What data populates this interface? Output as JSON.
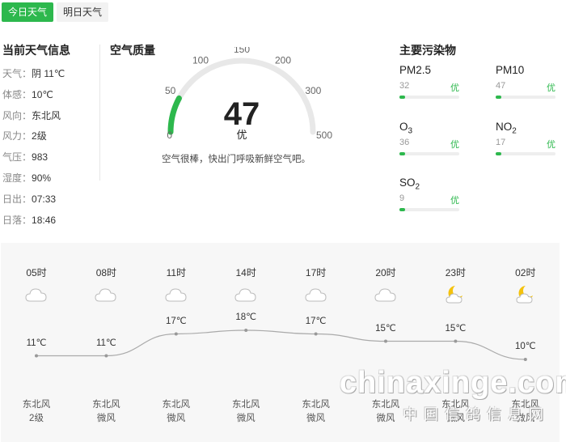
{
  "tabs": [
    {
      "label": "今日天气",
      "active": true
    },
    {
      "label": "明日天气",
      "active": false
    }
  ],
  "current": {
    "title": "当前天气信息",
    "items": [
      {
        "label": "天气：",
        "value": "阴 11℃"
      },
      {
        "label": "体感：",
        "value": "10℃"
      },
      {
        "label": "风向：",
        "value": "东北风"
      },
      {
        "label": "风力：",
        "value": "2级"
      },
      {
        "label": "气压：",
        "value": "983"
      },
      {
        "label": "湿度：",
        "value": "90%"
      },
      {
        "label": "日出：",
        "value": "07:33"
      },
      {
        "label": "日落：",
        "value": "18:46"
      }
    ]
  },
  "air_quality": {
    "title": "空气质量",
    "aqi": "47",
    "aqi_value": 47,
    "aqi_max": 500,
    "level": "优",
    "description": "空气很棒，快出门呼吸新鲜空气吧。",
    "scale_labels": [
      "0",
      "50",
      "100",
      "150",
      "200",
      "300",
      "500"
    ],
    "accent_color": "#2db84d"
  },
  "pollutants": {
    "title": "主要污染物",
    "items": [
      {
        "name": "PM2.5",
        "sub": "",
        "value": "32",
        "level": "优",
        "fill": 0.1
      },
      {
        "name": "PM10",
        "sub": "",
        "value": "47",
        "level": "优",
        "fill": 0.1
      },
      {
        "name": "O",
        "sub": "3",
        "value": "36",
        "level": "优",
        "fill": 0.1
      },
      {
        "name": "NO",
        "sub": "2",
        "value": "17",
        "level": "优",
        "fill": 0.1
      },
      {
        "name": "SO",
        "sub": "2",
        "value": "9",
        "level": "优",
        "fill": 0.1
      }
    ]
  },
  "forecast": {
    "hours": [
      {
        "time": "05时",
        "icon": "cloudy-icon",
        "temp": "11℃",
        "temp_value": 11,
        "wind_dir": "东北风",
        "wind_force": "2级"
      },
      {
        "time": "08时",
        "icon": "cloudy-icon",
        "temp": "11℃",
        "temp_value": 11,
        "wind_dir": "东北风",
        "wind_force": "微风"
      },
      {
        "time": "11时",
        "icon": "cloudy-icon",
        "temp": "17℃",
        "temp_value": 17,
        "wind_dir": "东北风",
        "wind_force": "微风"
      },
      {
        "time": "14时",
        "icon": "cloudy-icon",
        "temp": "18℃",
        "temp_value": 18,
        "wind_dir": "东北风",
        "wind_force": "微风"
      },
      {
        "time": "17时",
        "icon": "cloudy-icon",
        "temp": "17℃",
        "temp_value": 17,
        "wind_dir": "东北风",
        "wind_force": "微风"
      },
      {
        "time": "20时",
        "icon": "cloudy-icon",
        "temp": "15℃",
        "temp_value": 15,
        "wind_dir": "东北风",
        "wind_force": "微风"
      },
      {
        "time": "23时",
        "icon": "night-cloudy-icon",
        "temp": "15℃",
        "temp_value": 15,
        "wind_dir": "东北风",
        "wind_force": "微风"
      },
      {
        "time": "02时",
        "icon": "night-cloudy-icon",
        "temp": "10℃",
        "temp_value": 10,
        "wind_dir": "东北风",
        "wind_force": "微风"
      }
    ]
  },
  "watermark": {
    "latin": "chinaxinge.com",
    "cn": "中国信鸽信息网"
  }
}
